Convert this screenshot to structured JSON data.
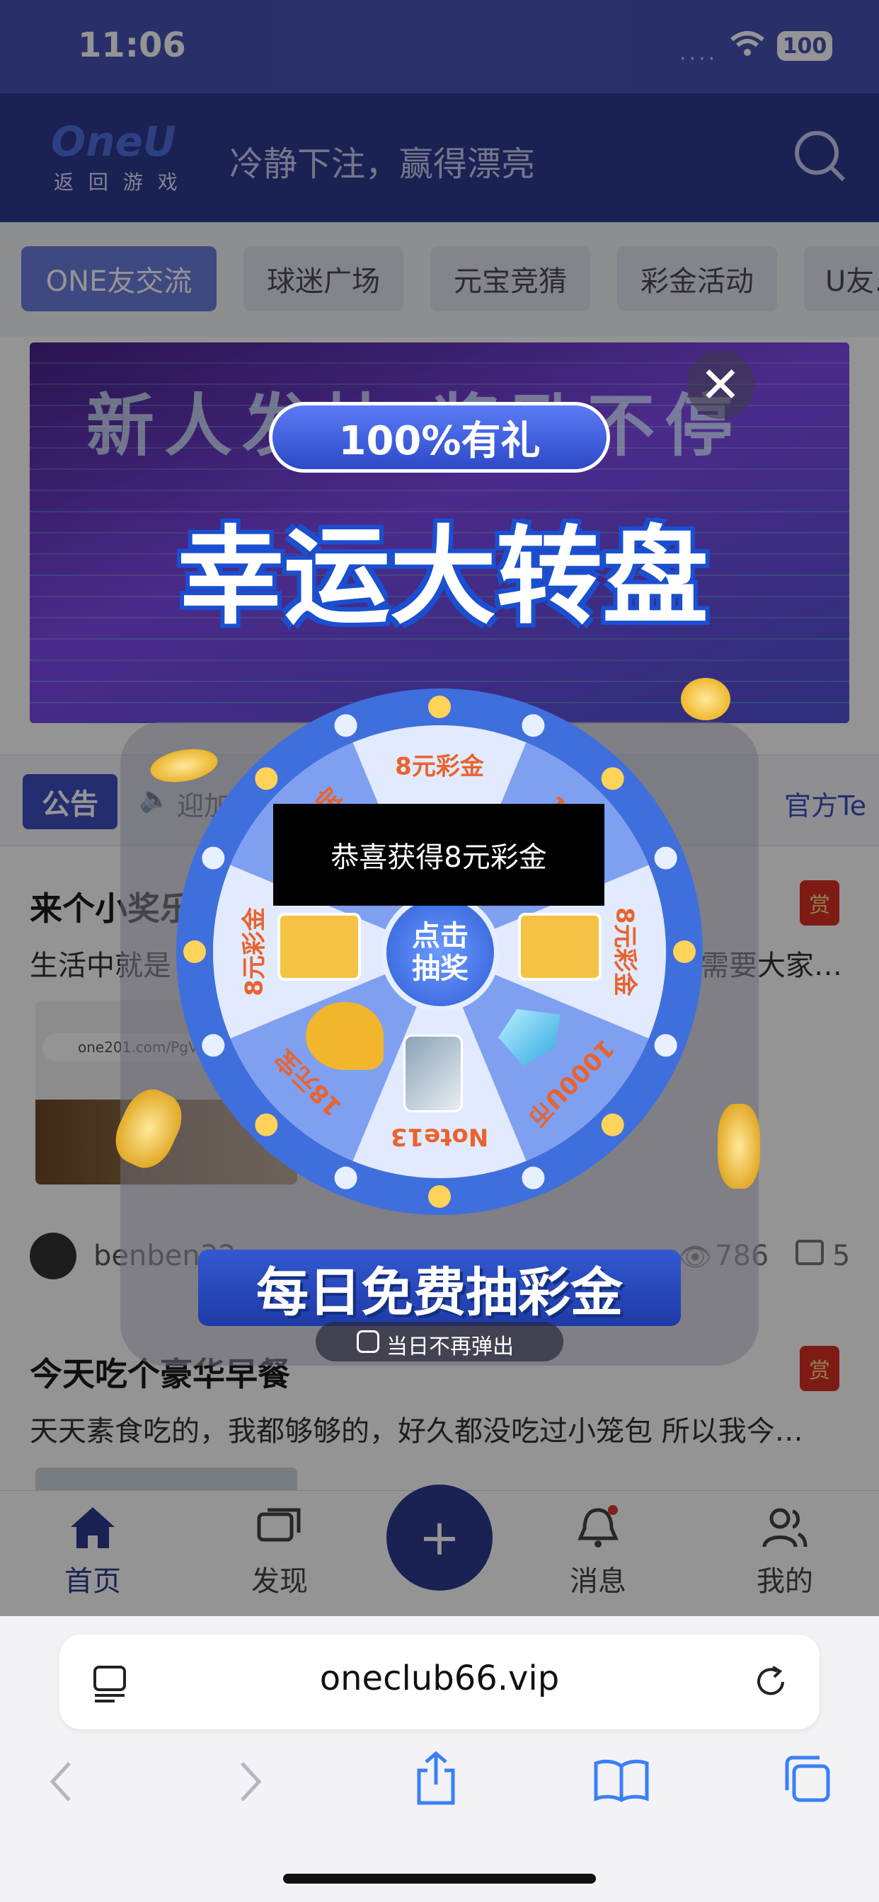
{
  "status": {
    "time": "11:06",
    "battery": "100"
  },
  "header": {
    "logo": "OneU",
    "logo_sub": "返 回 游 戏",
    "slogan": "冷静下注，赢得漂亮"
  },
  "tabs": [
    {
      "label": "ONE友交流",
      "active": true
    },
    {
      "label": "球迷广场"
    },
    {
      "label": "元宝竞猜"
    },
    {
      "label": "彩金活动"
    },
    {
      "label": "U友…"
    }
  ],
  "banner": {
    "bg_text": "新人发帖 奖励不停",
    "pill": "100%有礼",
    "title": "幸运大转盘"
  },
  "notice": {
    "badge": "公告",
    "text": "迎加",
    "right_text": "官方Te"
  },
  "posts": [
    {
      "title": "来个小奖乐",
      "body": "生活中就是",
      "body_tail": "需要大家…",
      "reward_badge": "赏",
      "thumb_url": "one201.com/PgVi",
      "author": "benben32",
      "views": "786",
      "comments": "5"
    },
    {
      "title": "今天吃个豪华早餐",
      "body": "天天素食吃的，我都够够的，好久都没吃过小笼包 所以我今…",
      "reward_badge": "赏"
    }
  ],
  "wheel": {
    "segments": [
      "8元彩金",
      "16元",
      "8元彩金",
      "1000U币",
      "Note13",
      "18元宝",
      "8元彩金",
      "18元宝"
    ],
    "center_label": "点击\n抽奖",
    "toast": "恭喜获得8元彩金",
    "footer_banner": "每日免费抽彩金",
    "checkbox_label": "当日不再弹出"
  },
  "bottom_nav": {
    "home": "首页",
    "discover": "发现",
    "add": "+",
    "messages": "消息",
    "mine": "我的"
  },
  "browser": {
    "url": "oneclub66.vip"
  },
  "colors": {
    "primary": "#4652b6",
    "header": "#2d3a8f",
    "wheel_blue": "#3f6fdc",
    "wheel_light": "#c9d8ff",
    "segment_text": "#e8632e"
  }
}
